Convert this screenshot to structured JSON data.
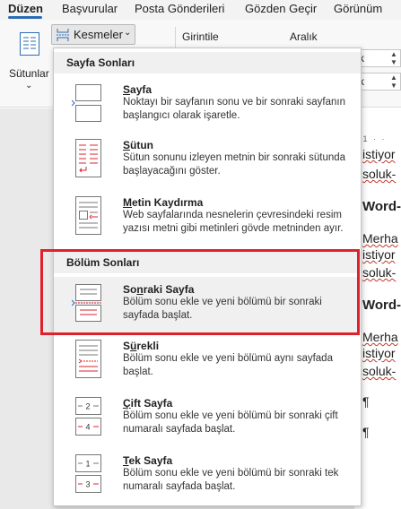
{
  "ribbon_tabs": [
    {
      "label": "Düzen",
      "active": true
    },
    {
      "label": "Başvurular",
      "active": false
    },
    {
      "label": "Posta Gönderileri",
      "active": false
    },
    {
      "label": "Gözden Geçir",
      "active": false
    },
    {
      "label": "Görünüm",
      "active": false
    }
  ],
  "ribbon": {
    "columns_label": "Sütunlar",
    "breaks_label": "Kesmeler",
    "indent_label": "Girintile",
    "spacing_label": "Aralık",
    "spin_fragment": "k"
  },
  "document": {
    "lines": [
      "istiyor",
      "soluk-",
      "Word-",
      "Merha",
      "istiyor",
      "soluk-",
      "Word-",
      "Merha",
      "istiyor",
      "soluk-",
      "¶",
      "¶"
    ]
  },
  "menu": {
    "page_breaks_header": "Sayfa Sonları",
    "section_breaks_header": "Bölüm Sonları",
    "items": [
      {
        "title": "Sayfa",
        "underline": "S",
        "rest": "ayfa",
        "desc": "Noktayı bir sayfanın sonu ve bir sonraki sayfanın başlangıcı olarak işaretle.",
        "icon": "page-break-icon"
      },
      {
        "title": "Sütun",
        "underline": "S",
        "rest": "ütun",
        "desc": "Sütun sonunu izleyen metnin bir sonraki sütunda başlayacağını göster.",
        "icon": "column-break-icon"
      },
      {
        "title": "Metin Kaydırma",
        "underline": "M",
        "rest": "etin Kaydırma",
        "desc": "Web sayfalarında nesnelerin çevresindeki resim yazısı metni gibi metinleri gövde metninden ayır.",
        "icon": "text-wrapping-break-icon"
      },
      {
        "title": "Sonraki Sayfa",
        "underline": "n",
        "pre": "So",
        "rest": "raki Sayfa",
        "desc": "Bölüm sonu ekle ve yeni bölümü bir sonraki sayfada başlat.",
        "icon": "next-page-section-break-icon"
      },
      {
        "title": "Sürekli",
        "underline": "ü",
        "pre": "S",
        "rest": "rekli",
        "desc": "Bölüm sonu ekle ve yeni bölümü aynı sayfada başlat.",
        "icon": "continuous-section-break-icon"
      },
      {
        "title": "Çift Sayfa",
        "underline": "Ç",
        "rest": "ift Sayfa",
        "desc": "Bölüm sonu ekle ve yeni bölümü bir sonraki çift numaralı sayfada başlat.",
        "icon": "even-page-section-break-icon"
      },
      {
        "title": "Tek Sayfa",
        "underline": "T",
        "rest": "ek Sayfa",
        "desc": "Bölüm sonu ekle ve yeni bölümü bir sonraki tek numaralı sayfada başlat.",
        "icon": "odd-page-section-break-icon"
      }
    ]
  },
  "colors": {
    "accent": "#2b6cb3",
    "highlight": "#e0202c",
    "icon_red": "#d9232e"
  }
}
